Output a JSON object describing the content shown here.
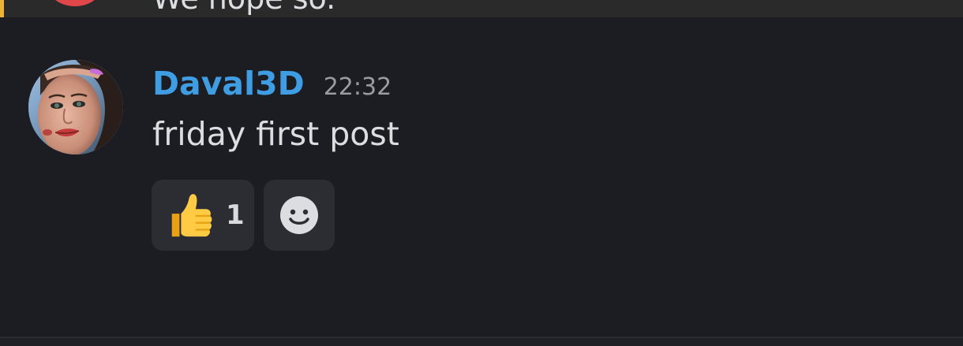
{
  "previous_message": {
    "text": "We hope so."
  },
  "message": {
    "author": "Daval3D",
    "timestamp": "22:32",
    "content": "friday first post",
    "reactions": [
      {
        "emoji": "thumbs-up-icon",
        "count": "1"
      }
    ],
    "add_reaction_icon": "smiley-icon"
  },
  "colors": {
    "background": "#1c1d22",
    "username": "#3f9ee3",
    "timestamp": "#9a9ca3",
    "text": "#dcdde0",
    "reaction_bg": "#2b2d33",
    "mention_bar": "#f0b232",
    "prev_avatar": "#e0474a"
  }
}
